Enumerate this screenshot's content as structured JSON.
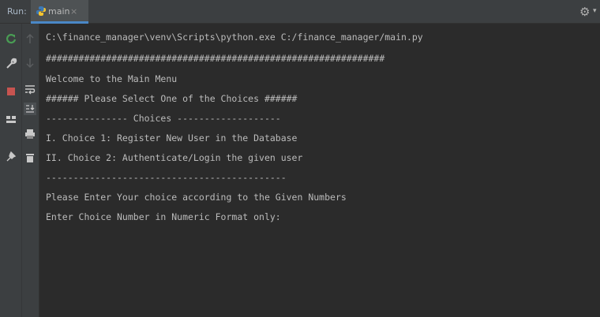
{
  "run_panel": {
    "label": "Run:",
    "tab_title": "main",
    "tab_close": "×"
  },
  "toolbar": {
    "buttons": [
      "rerun-icon",
      "up-arrow-icon",
      "wrench-icon",
      "down-arrow-icon",
      "stop-icon",
      "soft-wrap-icon",
      "layout-icon",
      "scroll-to-end-icon",
      "pin-icon",
      "print-icon",
      "delete-icon"
    ]
  },
  "console": {
    "lines": [
      "C:\\finance_manager\\venv\\Scripts\\python.exe C:/finance_manager/main.py",
      "##############################################################",
      "Welcome to the Main Menu",
      "###### Please Select One of the Choices ######",
      "--------------- Choices -------------------",
      "I. Choice 1: Register New User in the Database",
      "II. Choice 2: Authenticate/Login the given user",
      "--------------------------------------------",
      "Please Enter Your choice according to the Given Numbers",
      "Enter Choice Number in Numeric Format only:"
    ]
  },
  "colors": {
    "console_bg": "#2b2b2b",
    "toolbar_bg": "#3c3f41",
    "text": "#bbbbbb",
    "rerun_green": "#499c54",
    "stop_red": "#c75450",
    "tab_accent": "#4a88c7"
  }
}
